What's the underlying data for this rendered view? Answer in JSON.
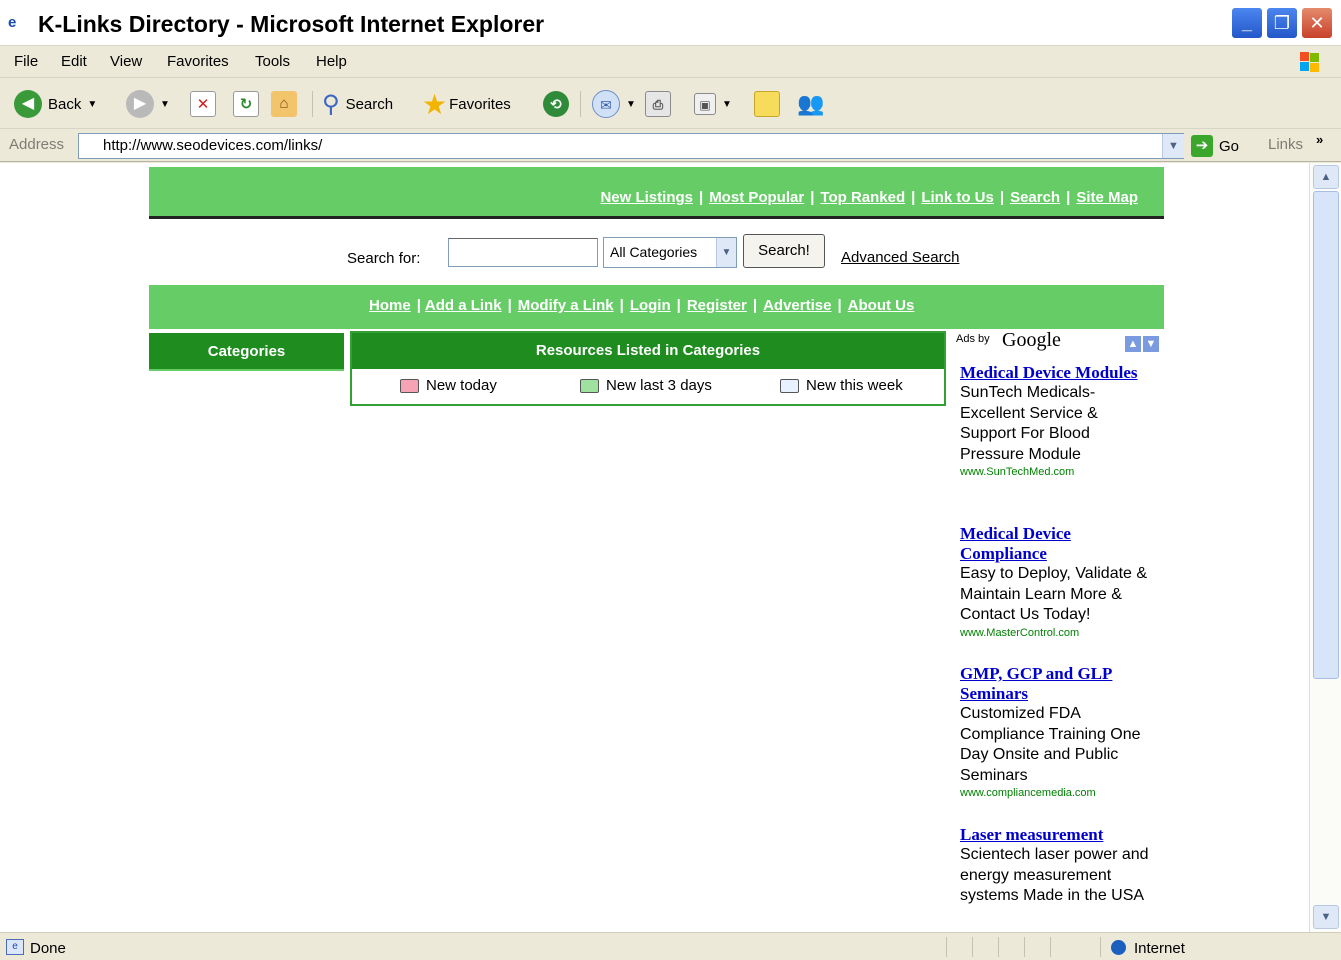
{
  "window": {
    "title": "K-Links Directory - Microsoft Internet Explorer"
  },
  "menu": [
    "File",
    "Edit",
    "View",
    "Favorites",
    "Tools",
    "Help"
  ],
  "toolbar": {
    "back_label": "Back",
    "search_label": "Search",
    "favorites_label": "Favorites"
  },
  "address": {
    "label": "Address",
    "url": "http://www.seodevices.com/links/",
    "go_label": "Go",
    "links_label": "Links"
  },
  "page": {
    "top_nav": [
      "New Listings",
      "Most Popular",
      "Top Ranked",
      "Link to Us",
      "Search",
      "Site Map"
    ],
    "search": {
      "label": "Search for:",
      "value": "",
      "category": "All Categories",
      "button": "Search!",
      "advanced": "Advanced Search"
    },
    "main_nav": [
      "Home",
      "Add a Link",
      "Modify a Link",
      "Login",
      "Register",
      "Advertise",
      "About Us"
    ],
    "categories_header": "Categories",
    "resources_header": "Resources Listed in Categories",
    "legend": [
      {
        "label": "New today",
        "color": "#f6a3b5"
      },
      {
        "label": "New last 3 days",
        "color": "#9fe29f"
      },
      {
        "label": "New this week",
        "color": "#e8f1ff"
      }
    ]
  },
  "ads": {
    "ads_by": "Ads by",
    "google": "Google",
    "items": [
      {
        "title": "Medical Device Modules",
        "body": "SunTech Medicals-Excellent Service & Support For Blood Pressure Module",
        "url": "www.SunTechMed.com"
      },
      {
        "title": "Medical Device Compliance",
        "body": "Easy to Deploy, Validate & Maintain Learn More & Contact Us Today!",
        "url": "www.MasterControl.com"
      },
      {
        "title": "GMP, GCP and GLP Seminars",
        "body": "Customized FDA Compliance Training One Day Onsite and Public Seminars",
        "url": "www.compliancemedia.com"
      },
      {
        "title": "Laser measurement",
        "body": "Scientech laser power and energy measurement systems Made in the USA",
        "url": ""
      }
    ]
  },
  "status": {
    "text": "Done",
    "zone": "Internet"
  },
  "colors": {
    "green_bar": "#66cc66",
    "dark_green": "#1e8c1e",
    "ad_link": "#0000cc",
    "ad_url": "#008000"
  }
}
